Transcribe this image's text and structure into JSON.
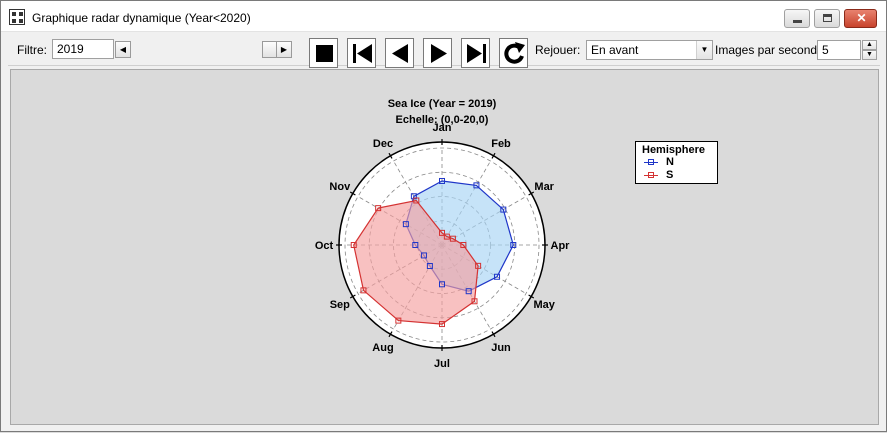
{
  "window": {
    "title": "Graphique radar dynamique (Year<2020)",
    "close_glyph": "✕"
  },
  "toolbar": {
    "filter_label": "Filtre:",
    "filter_value": "2019",
    "replay_label": "Rejouer:",
    "replay_value": "En avant",
    "fps_label": "Images par seconde:",
    "fps_value": "5",
    "buttons": [
      "stop",
      "first",
      "previous",
      "next",
      "last",
      "refresh"
    ]
  },
  "chart_data": {
    "type": "radar",
    "title": "Sea Ice (Year = 2019)",
    "subtitle": "Echelle: (0,0-20,0)",
    "range": [
      0,
      20
    ],
    "categories": [
      "Jan",
      "Feb",
      "Mar",
      "Apr",
      "May",
      "Jun",
      "Jul",
      "Aug",
      "Sep",
      "Oct",
      "Nov",
      "Dec"
    ],
    "legend_title": "Hemisphere",
    "legend_position": "right",
    "series": [
      {
        "name": "N",
        "color": "#1f36c8",
        "fill": "#a8d4f5",
        "values": [
          13.2,
          14.2,
          14.6,
          14.7,
          13.1,
          11.0,
          8.1,
          5.0,
          4.3,
          5.5,
          8.6,
          11.6
        ]
      },
      {
        "name": "S",
        "color": "#d43232",
        "fill": "#f5a0a0",
        "values": [
          2.5,
          2.0,
          2.6,
          4.4,
          8.6,
          13.4,
          16.3,
          18.0,
          18.7,
          18.2,
          15.2,
          10.6
        ]
      }
    ]
  }
}
